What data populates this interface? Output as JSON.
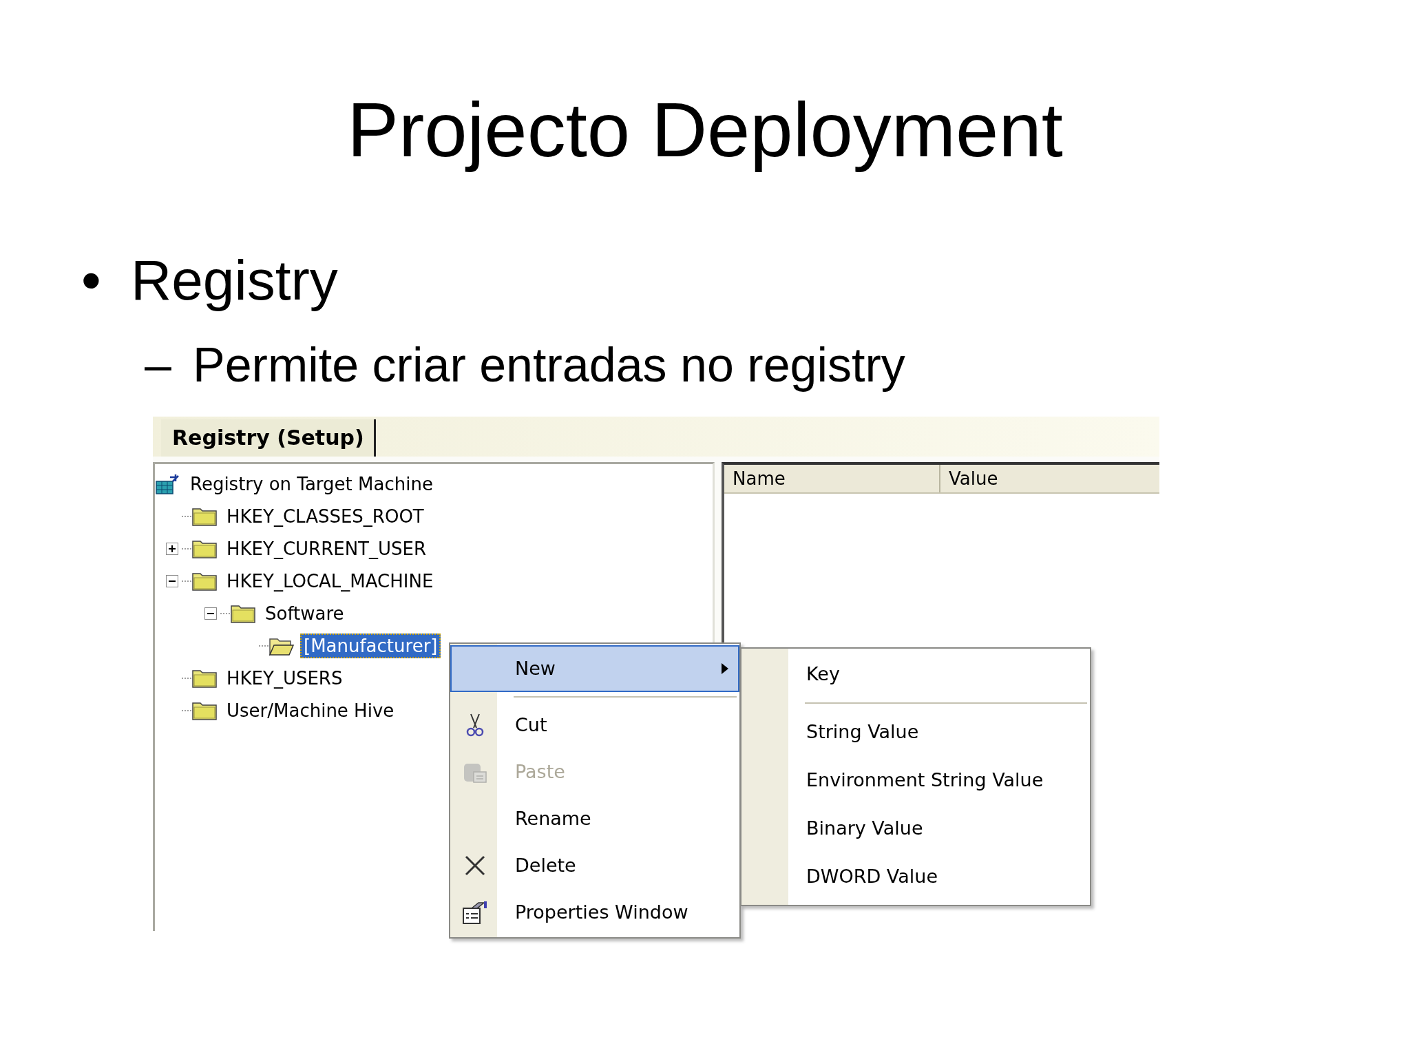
{
  "slide": {
    "title": "Projecto Deployment",
    "bullets": [
      {
        "marker": "•",
        "text": "Registry",
        "sub": [
          {
            "marker": "–",
            "text": "Permite criar entradas no registry"
          }
        ]
      }
    ]
  },
  "screenshot": {
    "tab": "Registry (Setup)",
    "tree": {
      "label": "Registry on Target Machine",
      "kind": "root",
      "selected": false,
      "children": [
        {
          "label": "HKEY_CLASSES_ROOT",
          "kind": "folder",
          "selected": false
        },
        {
          "label": "HKEY_CURRENT_USER",
          "kind": "folder",
          "selected": false,
          "expanded": false
        },
        {
          "label": "HKEY_LOCAL_MACHINE",
          "kind": "folder",
          "selected": false,
          "expanded": true,
          "children": [
            {
              "label": "Software",
              "kind": "folder",
              "selected": false,
              "expanded": true,
              "children": [
                {
                  "label": "[Manufacturer]",
                  "kind": "folder",
                  "selected": true
                }
              ]
            }
          ]
        },
        {
          "label": "HKEY_USERS",
          "kind": "folder",
          "selected": false
        },
        {
          "label": "User/Machine Hive",
          "kind": "folder",
          "selected": false
        }
      ]
    },
    "list_columns": [
      "Name",
      "Value"
    ],
    "context_menu": {
      "items": [
        {
          "kind": "item",
          "label": "New",
          "selected": true,
          "disabled": false,
          "submenu": true
        },
        {
          "kind": "separator"
        },
        {
          "kind": "item",
          "label": "Cut",
          "selected": false,
          "disabled": false,
          "submenu": false
        },
        {
          "kind": "item",
          "label": "Paste",
          "selected": false,
          "disabled": true,
          "submenu": false
        },
        {
          "kind": "item",
          "label": "Rename",
          "selected": false,
          "disabled": false,
          "submenu": false
        },
        {
          "kind": "item",
          "label": "Delete",
          "selected": false,
          "disabled": false,
          "submenu": false
        },
        {
          "kind": "item",
          "label": "Properties Window",
          "selected": false,
          "disabled": false,
          "submenu": false
        }
      ]
    },
    "submenu": {
      "items": [
        {
          "kind": "item",
          "label": "Key"
        },
        {
          "kind": "separator"
        },
        {
          "kind": "item",
          "label": "String Value"
        },
        {
          "kind": "item",
          "label": "Environment String Value"
        },
        {
          "kind": "item",
          "label": "Binary Value"
        },
        {
          "kind": "item",
          "label": "DWORD Value"
        }
      ]
    }
  }
}
